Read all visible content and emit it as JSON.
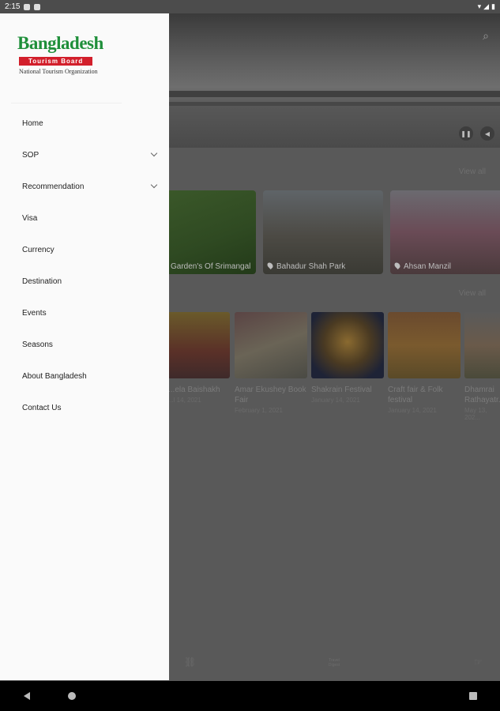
{
  "status_bar": {
    "time": "2:15",
    "icons": [
      "wifi-icon",
      "signal-icon",
      "battery-icon"
    ]
  },
  "drawer": {
    "logo": {
      "name": "Bangladesh",
      "band": "Tourism Board",
      "subtitle": "National Tourism Organization"
    },
    "menu": [
      {
        "label": "Home",
        "expandable": false
      },
      {
        "label": "SOP",
        "expandable": true
      },
      {
        "label": "Recommendation",
        "expandable": true
      },
      {
        "label": "Visa",
        "expandable": false
      },
      {
        "label": "Currency",
        "expandable": false
      },
      {
        "label": "Destination",
        "expandable": false
      },
      {
        "label": "Events",
        "expandable": false
      },
      {
        "label": "Seasons",
        "expandable": false
      },
      {
        "label": "About Bangladesh",
        "expandable": false
      },
      {
        "label": "Contact Us",
        "expandable": false
      }
    ]
  },
  "background": {
    "view_all_1": "View all",
    "view_all_2": "View all",
    "destinations": [
      {
        "label": "Garden's Of Srimangal"
      },
      {
        "label": "Bahadur Shah Park"
      },
      {
        "label": "Ahsan Manzil"
      }
    ],
    "events": [
      {
        "title": "...ela Baishakh",
        "date": "...l 14, 2021"
      },
      {
        "title": "Amar Ekushey Book Fair",
        "date": "February 1, 2021"
      },
      {
        "title": "Shakrain Festival",
        "date": "January 14, 2021"
      },
      {
        "title": "Craft fair & Folk festival",
        "date": "January 14, 2021"
      },
      {
        "title": "Dhamrai Rathayatr...",
        "date": "May 13, 202..."
      }
    ],
    "bottom_tab_mid": "Travel Digest"
  },
  "colors": {
    "logo_green": "#1f8f3a",
    "logo_red": "#d21f2b",
    "drawer_bg": "#fafafa",
    "scrim": "#595959"
  }
}
